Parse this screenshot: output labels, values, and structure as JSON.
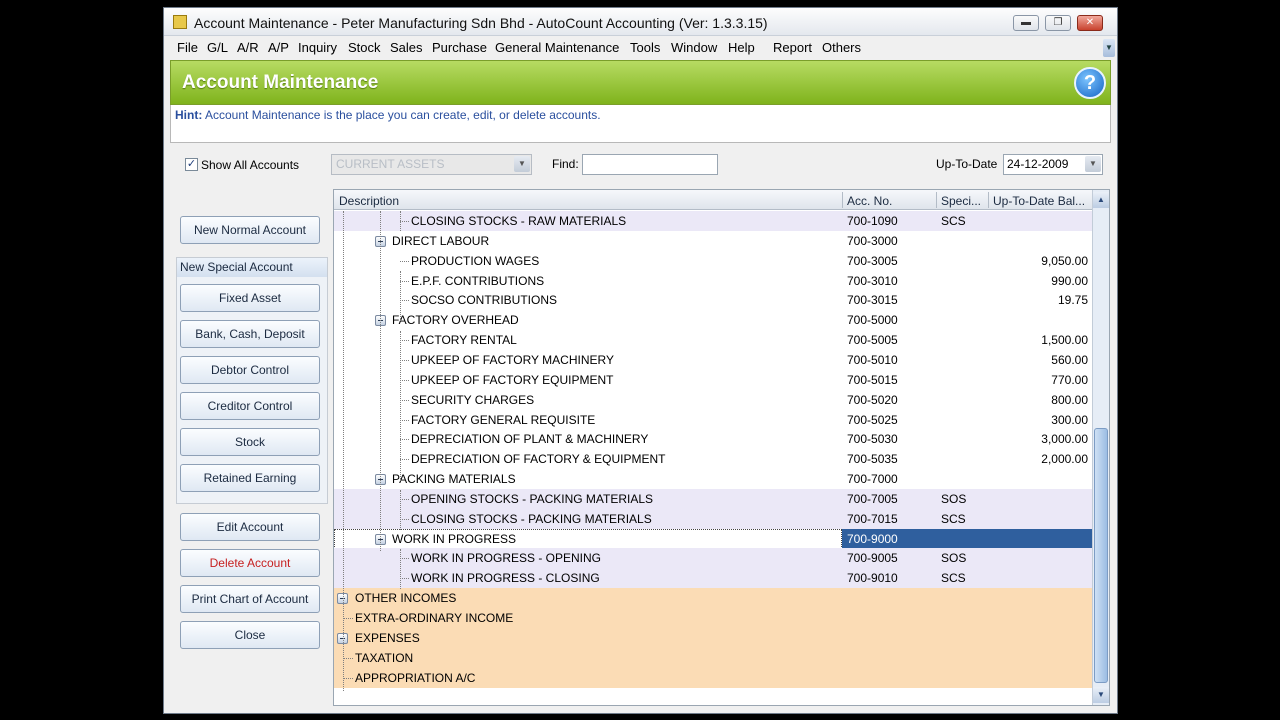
{
  "window": {
    "title": "Account Maintenance - Peter Manufacturing Sdn Bhd - AutoCount Accounting (Ver: 1.3.3.15)",
    "controls": [
      "minimize-icon",
      "restore-icon",
      "close-icon"
    ]
  },
  "menu": {
    "items": [
      "File",
      "G/L",
      "A/R",
      "A/P",
      "Inquiry",
      "Stock",
      "Sales",
      "Purchase",
      "General Maintenance",
      "Tools",
      "Window",
      "Help",
      "Report",
      "Others"
    ]
  },
  "banner": {
    "title": "Account Maintenance",
    "help_icon": "help-icon",
    "help_glyph": "?",
    "accent_color": "#8fc23a"
  },
  "hint": {
    "label": "Hint:",
    "text": "Account Maintenance is the place you can create, edit, or delete accounts."
  },
  "toolbar": {
    "show_all_label": "Show All Accounts",
    "show_all_checked": true,
    "account_type_value": "CURRENT ASSETS",
    "find_label": "Find:",
    "find_value": "",
    "uptodate_label": "Up-To-Date",
    "uptodate_value": "24-12-2009"
  },
  "left": {
    "new_normal": "New Normal Account",
    "special_header": "New Special Account",
    "special_buttons": [
      "Fixed Asset",
      "Bank, Cash, Deposit",
      "Debtor Control",
      "Creditor Control",
      "Stock",
      "Retained Earning"
    ],
    "edit": "Edit Account",
    "delete": "Delete Account",
    "print": "Print Chart of Account",
    "close": "Close"
  },
  "grid": {
    "columns": [
      "Description",
      "Acc. No.",
      "Speci...",
      "Up-To-Date Bal..."
    ],
    "rows": [
      {
        "desc": "CLOSING STOCKS - RAW MATERIALS",
        "acc": "700-1090",
        "spec": "SCS",
        "bal": "",
        "level": 2,
        "style": "lav"
      },
      {
        "desc": "DIRECT LABOUR",
        "acc": "700-3000",
        "spec": "",
        "bal": "",
        "level": 1,
        "style": "",
        "expander": true
      },
      {
        "desc": "PRODUCTION WAGES",
        "acc": "700-3005",
        "spec": "",
        "bal": "9,050.00",
        "level": 2,
        "style": ""
      },
      {
        "desc": "E.P.F. CONTRIBUTIONS",
        "acc": "700-3010",
        "spec": "",
        "bal": "990.00",
        "level": 2,
        "style": ""
      },
      {
        "desc": "SOCSO CONTRIBUTIONS",
        "acc": "700-3015",
        "spec": "",
        "bal": "19.75",
        "level": 2,
        "style": ""
      },
      {
        "desc": "FACTORY OVERHEAD",
        "acc": "700-5000",
        "spec": "",
        "bal": "",
        "level": 1,
        "style": "",
        "expander": true
      },
      {
        "desc": "FACTORY RENTAL",
        "acc": "700-5005",
        "spec": "",
        "bal": "1,500.00",
        "level": 2,
        "style": ""
      },
      {
        "desc": "UPKEEP OF FACTORY MACHINERY",
        "acc": "700-5010",
        "spec": "",
        "bal": "560.00",
        "level": 2,
        "style": ""
      },
      {
        "desc": "UPKEEP OF FACTORY EQUIPMENT",
        "acc": "700-5015",
        "spec": "",
        "bal": "770.00",
        "level": 2,
        "style": ""
      },
      {
        "desc": "SECURITY CHARGES",
        "acc": "700-5020",
        "spec": "",
        "bal": "800.00",
        "level": 2,
        "style": ""
      },
      {
        "desc": "FACTORY GENERAL REQUISITE",
        "acc": "700-5025",
        "spec": "",
        "bal": "300.00",
        "level": 2,
        "style": ""
      },
      {
        "desc": "DEPRECIATION OF PLANT & MACHINERY",
        "acc": "700-5030",
        "spec": "",
        "bal": "3,000.00",
        "level": 2,
        "style": ""
      },
      {
        "desc": "DEPRECIATION OF FACTORY & EQUIPMENT",
        "acc": "700-5035",
        "spec": "",
        "bal": "2,000.00",
        "level": 2,
        "style": ""
      },
      {
        "desc": "PACKING MATERIALS",
        "acc": "700-7000",
        "spec": "",
        "bal": "",
        "level": 1,
        "style": "",
        "expander": true
      },
      {
        "desc": "OPENING STOCKS - PACKING MATERIALS",
        "acc": "700-7005",
        "spec": "SOS",
        "bal": "",
        "level": 2,
        "style": "lav"
      },
      {
        "desc": "CLOSING STOCKS - PACKING MATERIALS",
        "acc": "700-7015",
        "spec": "SCS",
        "bal": "",
        "level": 2,
        "style": "lav"
      },
      {
        "desc": "WORK IN PROGRESS",
        "acc": "700-9000",
        "spec": "",
        "bal": "",
        "level": 1,
        "style": "sel",
        "expander": true
      },
      {
        "desc": "WORK IN PROGRESS - OPENING",
        "acc": "700-9005",
        "spec": "SOS",
        "bal": "",
        "level": 2,
        "style": "lav"
      },
      {
        "desc": "WORK IN PROGRESS - CLOSING",
        "acc": "700-9010",
        "spec": "SCS",
        "bal": "",
        "level": 2,
        "style": "lav"
      },
      {
        "desc": "OTHER INCOMES",
        "acc": "",
        "spec": "",
        "bal": "",
        "level": 0,
        "style": "org",
        "expander": true
      },
      {
        "desc": "EXTRA-ORDINARY INCOME",
        "acc": "",
        "spec": "",
        "bal": "",
        "level": 0,
        "style": "org"
      },
      {
        "desc": "EXPENSES",
        "acc": "",
        "spec": "",
        "bal": "",
        "level": 0,
        "style": "org",
        "expander": true
      },
      {
        "desc": "TAXATION",
        "acc": "",
        "spec": "",
        "bal": "",
        "level": 0,
        "style": "org"
      },
      {
        "desc": "APPROPRIATION A/C",
        "acc": "",
        "spec": "",
        "bal": "",
        "level": 0,
        "style": "org"
      }
    ],
    "selected_color": "#2f5f9e",
    "lavender_color": "#ebe8f7",
    "orange_color": "#fbdcb5"
  }
}
